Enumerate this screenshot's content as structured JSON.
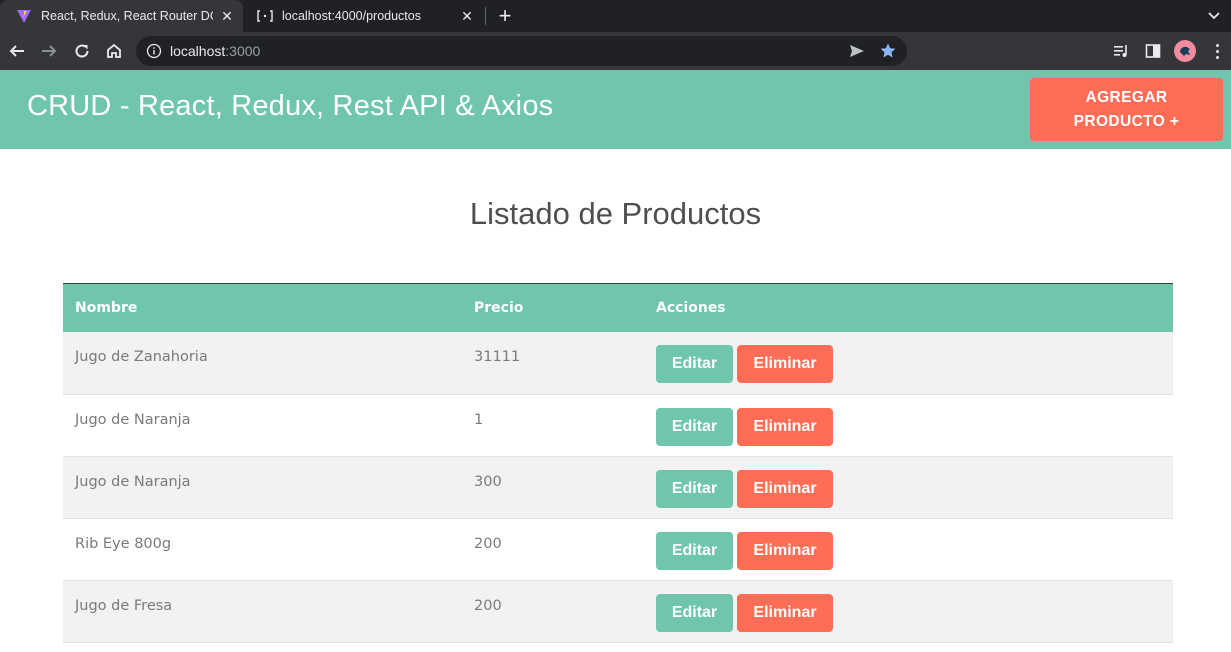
{
  "browser": {
    "tabs": [
      {
        "title": "React, Redux, React Router DOM",
        "active": true,
        "icon": "vite-icon"
      },
      {
        "title": "localhost:4000/productos",
        "active": false,
        "icon": "globe-icon"
      }
    ],
    "address": {
      "host": "localhost",
      "port": ":3000"
    },
    "colors": {
      "tabstrip": "#202124",
      "toolbar": "#35363a",
      "star": "#8ab4f8"
    }
  },
  "app": {
    "title": "CRUD - React, Redux, Rest API & Axios",
    "add_button": "AGREGAR PRODUCTO +",
    "colors": {
      "primary": "#6fc6ad",
      "danger": "#ff6d57"
    }
  },
  "main": {
    "heading": "Listado de Productos",
    "table": {
      "headers": [
        "Nombre",
        "Precio",
        "Acciones"
      ],
      "edit_label": "Editar",
      "delete_label": "Eliminar",
      "rows": [
        {
          "nombre": "Jugo de Zanahoria",
          "precio": "31111"
        },
        {
          "nombre": "Jugo de Naranja",
          "precio": "1"
        },
        {
          "nombre": "Jugo de Naranja",
          "precio": "300"
        },
        {
          "nombre": "Rib Eye 800g",
          "precio": "200"
        },
        {
          "nombre": "Jugo de Fresa",
          "precio": "200"
        }
      ]
    }
  }
}
